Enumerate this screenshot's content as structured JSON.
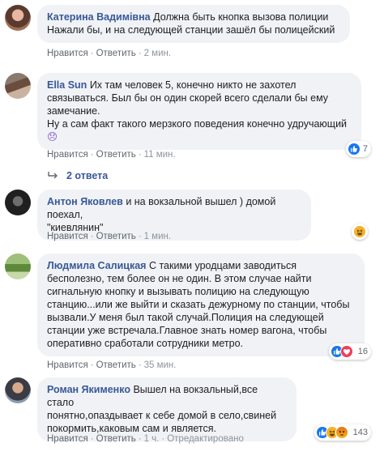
{
  "comments": [
    {
      "author": "Катерина Вадимівна",
      "text": "Должна быть кнопка вызова полиции\nНажали бы, и на следующей станции зашёл бы полицейский",
      "like": "Нравится",
      "reply": "Ответить",
      "time": "2 мин."
    },
    {
      "author": "Ella Sun",
      "text": "Их там человек 5, конечно никто не захотел\nсвязываться. Был бы он один скорей всего сделали бы ему\nзамечание.\nНу а сам факт такого мерзкого поведения конечно удручающий",
      "emoji": "😞",
      "like": "Нравится",
      "reply": "Ответить",
      "time": "11 мин.",
      "reaction_count": "7"
    },
    {
      "author": "Антон Яковлев",
      "text": "и на вокзальной вышел ) домой поехал,\n\"киевлянин\"",
      "like": "Нравится",
      "reply": "Ответить",
      "time": "1 мин."
    },
    {
      "author": "Людмила Салицкая",
      "text": "С такими уродцами заводиться\nбесполезно, тем более он не один. В этом случае найти\nсигнальную кнопку и вызывать полицию на следующую\nстанцию...или же выйти и сказать дежурному по станции, чтобы\nвызвали.У меня был такой случай.Полиция на следующей\nстанции уже встречала.Главное знать номер вагона, чтобы\nоперативно сработали сотрудники метро.",
      "like": "Нравится",
      "reply": "Ответить",
      "time": "35 мин.",
      "reaction_count": "16"
    },
    {
      "author": "Роман Якименко",
      "text": "Вышел на вокзальный,все стало\nпонятно,опаздывает к себе домой в село,свиней\nпокормить,каковым сам и является.",
      "like": "Нравится",
      "reply": "Ответить",
      "time": "1 ч.",
      "edited": "Отредактировано",
      "reaction_count": "143"
    }
  ],
  "replies_label": "2 ответа",
  "colors": {
    "link": "#385898",
    "bubble": "#f0f2f5",
    "meta": "#8d949e",
    "like_blue": "#1877f2",
    "love_red": "#f33e58",
    "haha_yellow": "#f7b125"
  }
}
